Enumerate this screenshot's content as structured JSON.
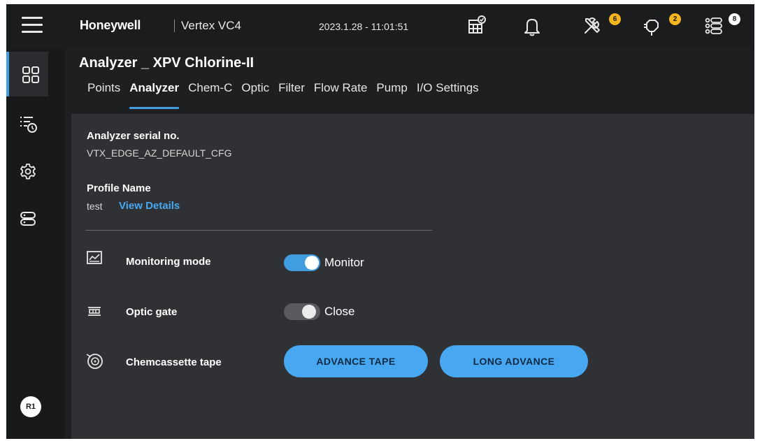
{
  "header": {
    "brand": "Honeywell",
    "product": "Vertex VC4",
    "datetime": "2023.1.28 - 11:01:51",
    "icons": [
      {
        "name": "building-calendar-icon",
        "badge": ""
      },
      {
        "name": "bell-icon",
        "badge": ""
      },
      {
        "name": "tools-icon",
        "badge": "6"
      },
      {
        "name": "plug-icon",
        "badge": "2"
      },
      {
        "name": "list-icon",
        "badge": "8"
      }
    ],
    "badge_colors": {
      "amber": "#f5b51f",
      "white": "#ffffff"
    }
  },
  "sidebar": {
    "items": [
      {
        "name": "dashboard-icon",
        "active": true
      },
      {
        "name": "event-history-icon",
        "active": false
      },
      {
        "name": "settings-gear-icon",
        "active": false
      },
      {
        "name": "rack-icon",
        "active": false
      }
    ],
    "user_initials": "R1"
  },
  "page": {
    "title": "Analyzer _ XPV Chlorine-II",
    "tabs": [
      "Points",
      "Analyzer",
      "Chem-C",
      "Optic",
      "Filter",
      "Flow Rate",
      "Pump",
      "I/O Settings"
    ],
    "active_tab": "Analyzer"
  },
  "analyzer": {
    "serial_label": "Analyzer serial no.",
    "serial_value": "VTX_EDGE_AZ_DEFAULT_CFG",
    "profile_label": "Profile Name",
    "profile_value": "test",
    "view_details": "View Details"
  },
  "controls": {
    "monitoring_mode": {
      "label": "Monitoring mode",
      "state": "Monitor",
      "on": true
    },
    "optic_gate": {
      "label": "Optic gate",
      "state": "Close",
      "on": false
    },
    "chemcassette": {
      "label": "Chemcassette tape",
      "advance": "ADVANCE TAPE",
      "long_advance": "LONG ADVANCE"
    }
  },
  "colors": {
    "accent": "#3f9de0",
    "button": "#47a7f0",
    "panel": "#303134",
    "background": "#1e1f21"
  }
}
